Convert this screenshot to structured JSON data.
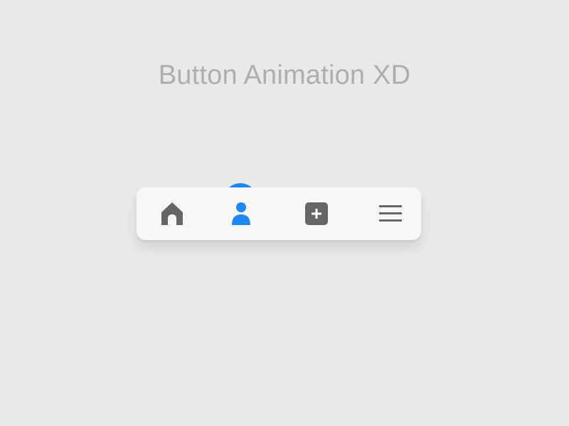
{
  "page": {
    "title": "Button Animation XD"
  },
  "nav_bar": {
    "items": [
      {
        "id": "home",
        "icon": "home-icon",
        "active": false
      },
      {
        "id": "profile",
        "icon": "user-icon",
        "active": true
      },
      {
        "id": "add",
        "icon": "plus-square-icon",
        "active": false
      },
      {
        "id": "menu",
        "icon": "hamburger-menu-icon",
        "active": false
      }
    ]
  },
  "colors": {
    "background": "#e9e9e7",
    "bar": "#f7f8f6",
    "accent": "#1e88f0",
    "icon_inactive": "#666666",
    "title_text": "#aeaeae"
  }
}
